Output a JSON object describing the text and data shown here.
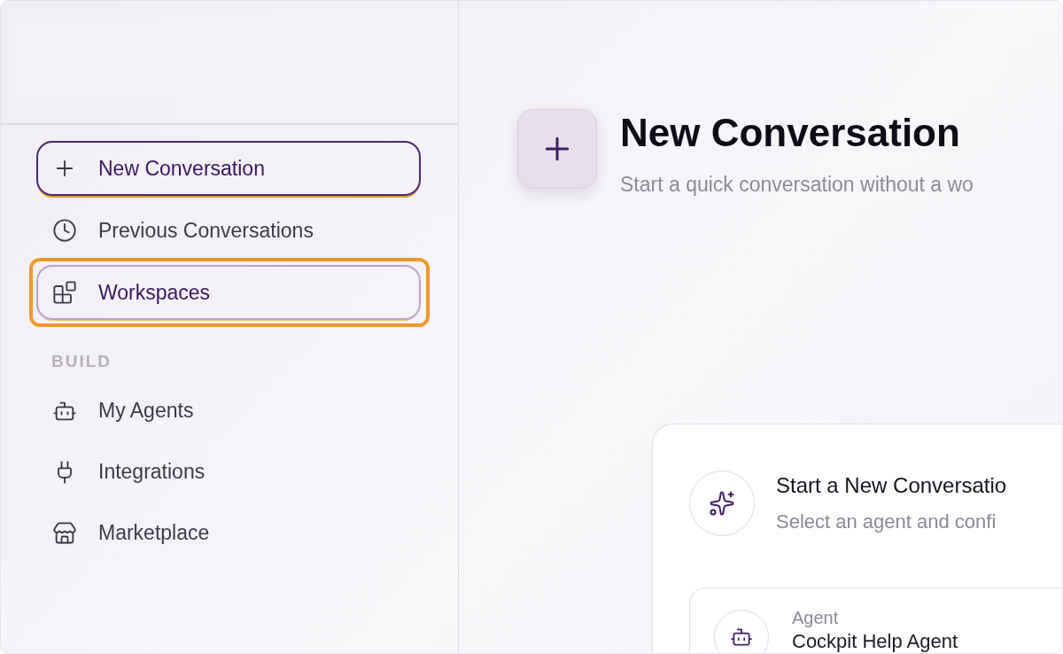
{
  "sidebar": {
    "items": [
      {
        "label": "New Conversation",
        "selected": true,
        "highlighted": false
      },
      {
        "label": "Previous Conversations",
        "selected": false,
        "highlighted": false
      },
      {
        "label": "Workspaces",
        "selected": false,
        "highlighted": true
      }
    ],
    "section_label": "BUILD",
    "build_items": [
      {
        "label": "My Agents"
      },
      {
        "label": "Integrations"
      },
      {
        "label": "Marketplace"
      }
    ]
  },
  "main": {
    "title": "New Conversation",
    "subtitle": "Start a quick conversation without a wo",
    "card": {
      "title": "Start a New Conversatio",
      "subtitle": "Select an agent and confi",
      "agent": {
        "label": "Agent",
        "value": "Cockpit Help Agent"
      }
    }
  }
}
